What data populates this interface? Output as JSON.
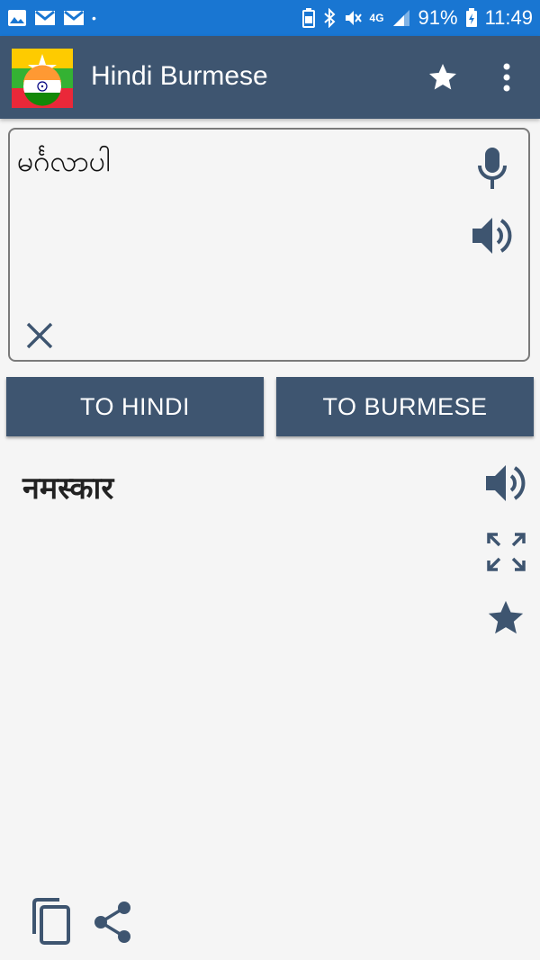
{
  "status_bar": {
    "battery": "91%",
    "time": "11:49",
    "network": "4G"
  },
  "app_bar": {
    "title": "Hindi Burmese"
  },
  "input": {
    "text": "မင်္ဂလာပါ"
  },
  "buttons": {
    "to_hindi": "TO HINDI",
    "to_burmese": "TO BURMESE"
  },
  "output": {
    "text": "नमस्कार"
  },
  "colors": {
    "status_bar": "#1976d2",
    "app_bar": "#3e5570",
    "icon": "#3e5570",
    "background": "#f5f5f5"
  },
  "icons": [
    "gallery-icon",
    "gmail-icon",
    "bluetooth-icon",
    "mute-icon",
    "signal-icon",
    "battery-icon",
    "star-icon",
    "overflow-menu-icon",
    "mic-icon",
    "speaker-icon",
    "clear-icon",
    "fullscreen-icon",
    "copy-icon",
    "share-icon"
  ]
}
